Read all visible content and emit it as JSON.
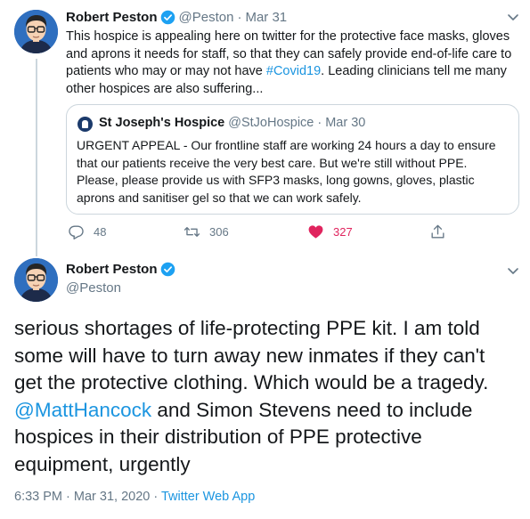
{
  "tweet1": {
    "author_name": "Robert Peston",
    "handle": "@Peston",
    "separator": "·",
    "date": "Mar 31",
    "text_before": "This hospice is appealing here on twitter for the protective face masks, gloves and aprons it needs for staff, so that they can safely provide end-of-life care to patients who may or may not have ",
    "hashtag": "#Covid19",
    "text_after": ". Leading clinicians tell me many other hospices are also suffering...",
    "quote": {
      "author_name": "St Joseph's Hospice",
      "handle": "@StJoHospice",
      "separator": "·",
      "date": "Mar 30",
      "text": "URGENT APPEAL - Our frontline staff are working 24 hours a day to ensure that our patients receive the very best care. But we're still without PPE. Please, please provide us with SFP3 masks, long gowns, gloves, plastic aprons and sanitiser gel so that we can work safely."
    },
    "replies": "48",
    "retweets": "306",
    "likes": "327"
  },
  "tweet2": {
    "author_name": "Robert Peston",
    "handle": "@Peston",
    "text_before": "serious shortages of life-protecting PPE kit. I am told some will have to turn away new inmates if they can't get the protective clothing. Which would be a tragedy. ",
    "mention": "@MattHancock",
    "text_after": " and Simon Stevens need to include hospices in their distribution of PPE protective equipment, urgently",
    "timestamp": "6:33 PM · Mar 31, 2020",
    "meta_separator": " · ",
    "app": "Twitter Web App"
  },
  "colors": {
    "link": "#1b95e0",
    "secondary_text": "#657786",
    "like": "#e0245e",
    "border": "#ccd6dd"
  },
  "icons": [
    "verified-badge-icon",
    "chevron-down-icon",
    "reply-icon",
    "retweet-icon",
    "heart-icon",
    "share-icon"
  ]
}
